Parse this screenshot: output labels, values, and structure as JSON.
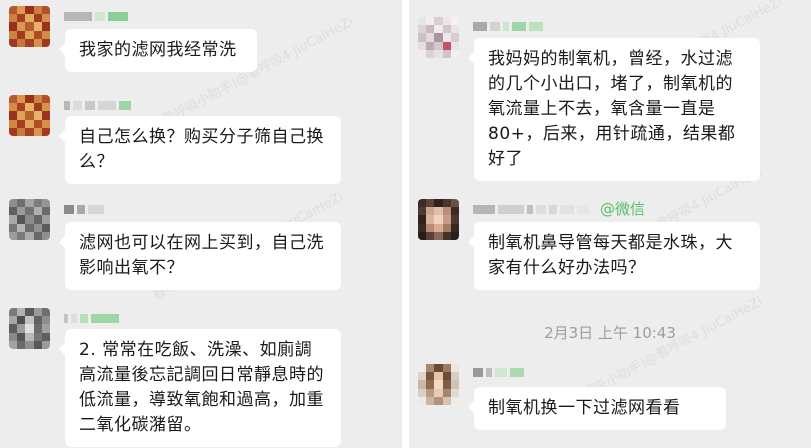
{
  "left": {
    "messages": [
      {
        "sender_tag": "",
        "text": "我家的滤网我经常洗"
      },
      {
        "sender_tag": "",
        "text": "自己怎么换？购买分子筛自己换么？"
      },
      {
        "sender_tag": "",
        "text": "滤网也可以在网上买到，自己洗影响出氧不？"
      },
      {
        "sender_tag": "",
        "text": "2. 常常在吃飯、洗澡、如廁調高流量後忘記調回日常靜息時的低流量，導致氧飽和過高，加重二氧化碳潴留。"
      }
    ]
  },
  "right": {
    "messages": [
      {
        "sender_tag": "",
        "text": "我妈妈的制氧机，曾经，水过滤的几个小出口，堵了，制氧机的氧流量上不去，氧含量一直是80+，后来，用针疏通，结果都好了"
      },
      {
        "sender_tag": "@微信",
        "text": "制氧机鼻导管每天都是水珠，大家有什么好办法吗？"
      },
      {
        "sender_tag": "",
        "text": "制氧机换一下过滤网看看"
      }
    ],
    "timestamp": "2月3日  上午 10:43"
  },
  "watermark": "看呼吸小助手)@看呼吸4 JiuCaiHeZi"
}
